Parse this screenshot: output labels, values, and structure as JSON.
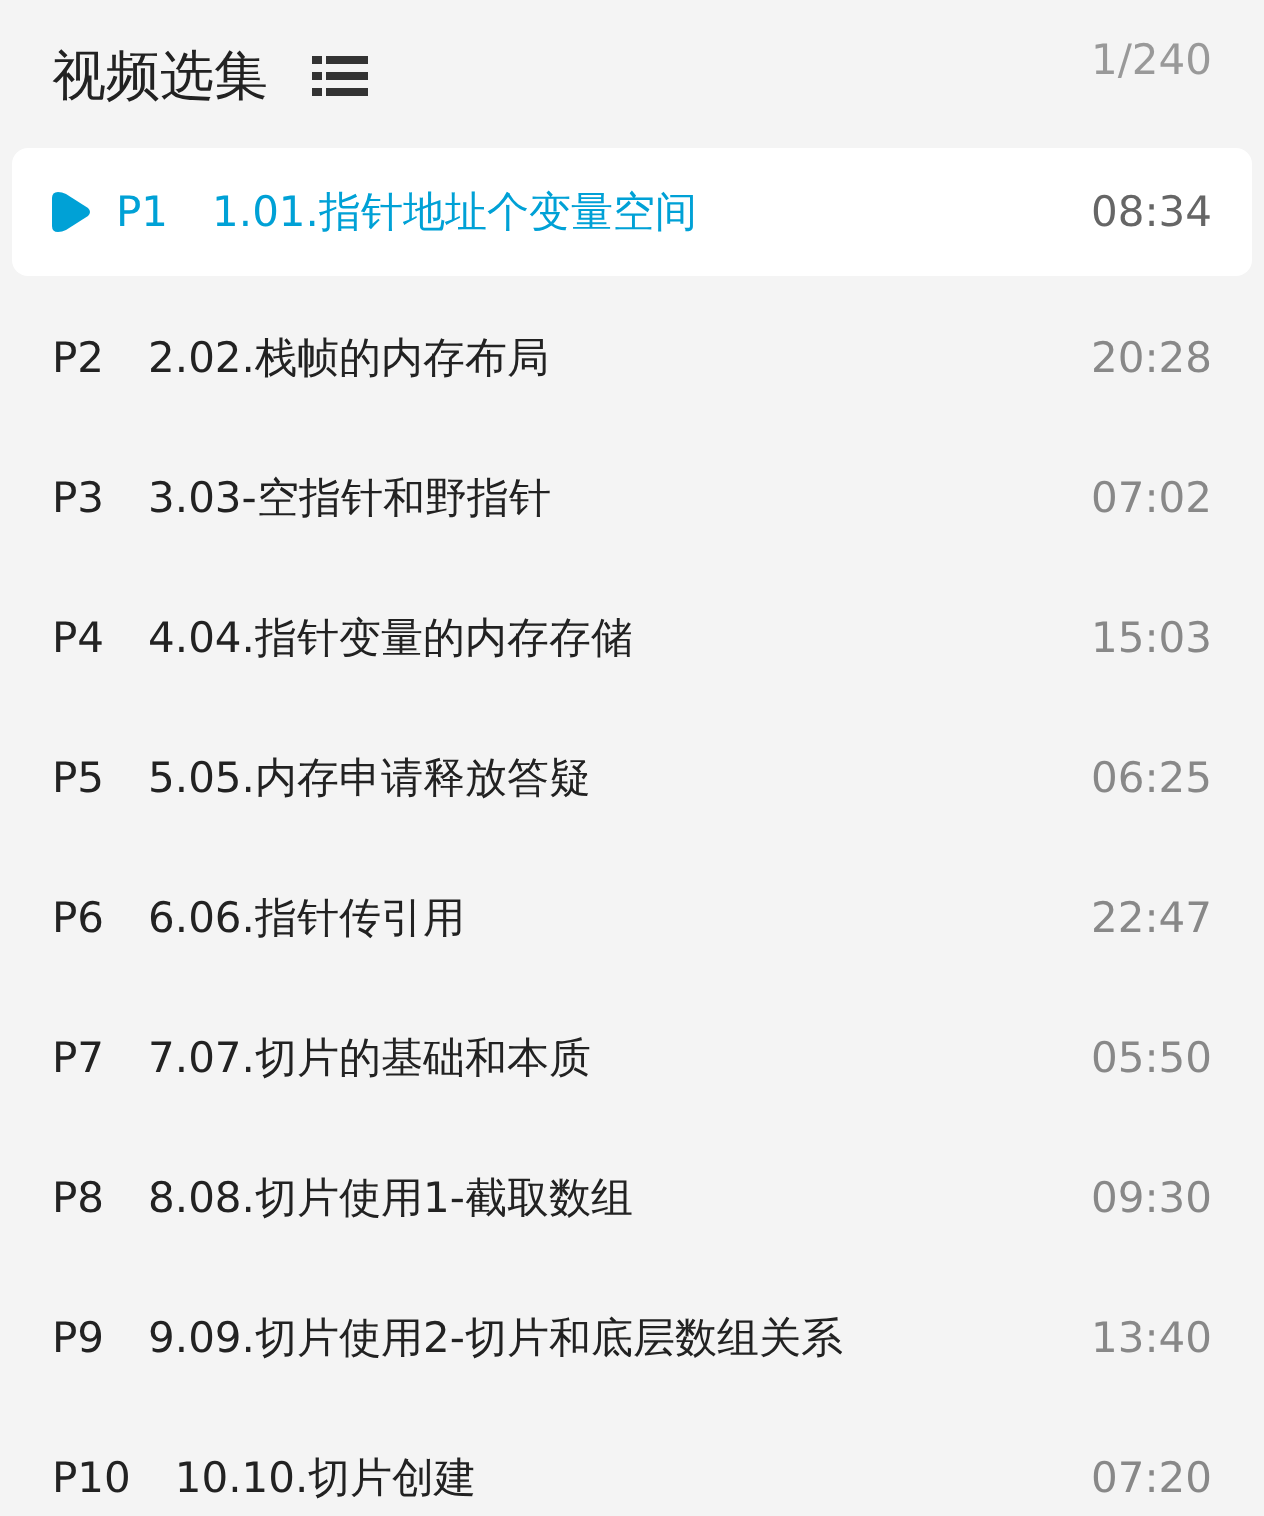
{
  "header": {
    "title": "视频选集",
    "counter": "1/240"
  },
  "episodes": [
    {
      "part": "P1",
      "title": "1.01.指针地址个变量空间",
      "duration": "08:34",
      "selected": true
    },
    {
      "part": "P2",
      "title": "2.02.栈帧的内存布局",
      "duration": "20:28",
      "selected": false
    },
    {
      "part": "P3",
      "title": "3.03-空指针和野指针",
      "duration": "07:02",
      "selected": false
    },
    {
      "part": "P4",
      "title": "4.04.指针变量的内存存储",
      "duration": "15:03",
      "selected": false
    },
    {
      "part": "P5",
      "title": "5.05.内存申请释放答疑",
      "duration": "06:25",
      "selected": false
    },
    {
      "part": "P6",
      "title": "6.06.指针传引用",
      "duration": "22:47",
      "selected": false
    },
    {
      "part": "P7",
      "title": "7.07.切片的基础和本质",
      "duration": "05:50",
      "selected": false
    },
    {
      "part": "P8",
      "title": "8.08.切片使用1-截取数组",
      "duration": "09:30",
      "selected": false
    },
    {
      "part": "P9",
      "title": "9.09.切片使用2-切片和底层数组关系",
      "duration": "13:40",
      "selected": false
    },
    {
      "part": "P10",
      "title": "10.10.切片创建",
      "duration": "07:20",
      "selected": false
    }
  ]
}
